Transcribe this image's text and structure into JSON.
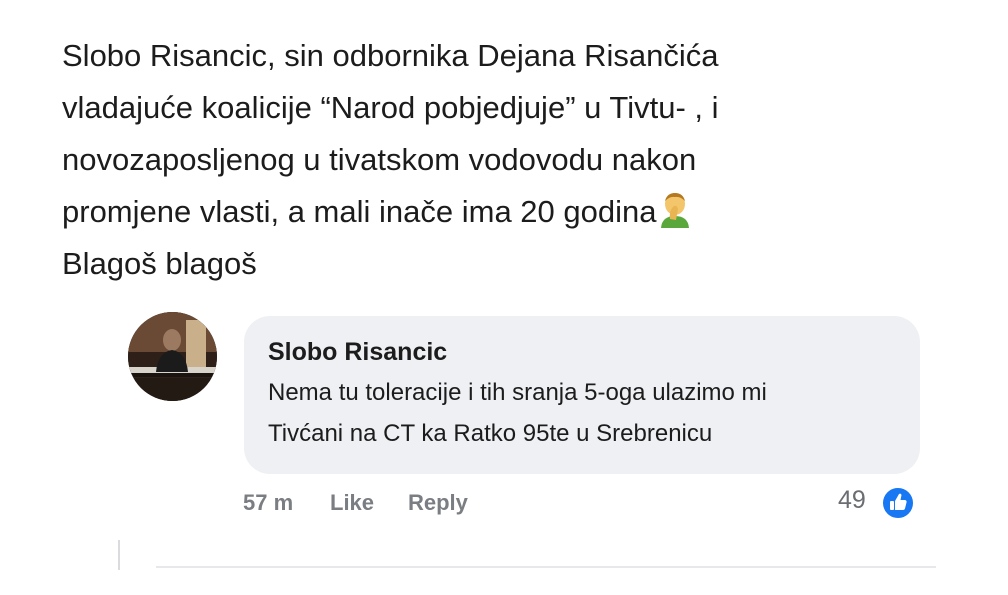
{
  "post": {
    "lines": [
      "Slobo Risancic, sin odbornika Dejana Risančića",
      "vladajuće koalicije “Narod pobjedjuje” u Tivtu- , i",
      "novozaposljenog u tivatskom vodovodu nakon",
      "promjene vlasti, a mali inače ima 20 godina",
      "Blagoš blagoš"
    ],
    "emoji": "face-palm-emoji"
  },
  "comment": {
    "author": "Slobo Risancic",
    "lines": [
      "Nema tu toleracije i tih sranja 5-oga ulazimo mi",
      "Tivćani na CT ka Ratko 95te u Srebrenicu"
    ],
    "time": "57 m",
    "like_label": "Like",
    "reply_label": "Reply",
    "reaction_count": "49",
    "reaction_icon": "thumbs-up-icon"
  },
  "colors": {
    "bubble": "#eef0f3",
    "meta_text": "#7a7d82",
    "like_blue": "#1877f2"
  }
}
